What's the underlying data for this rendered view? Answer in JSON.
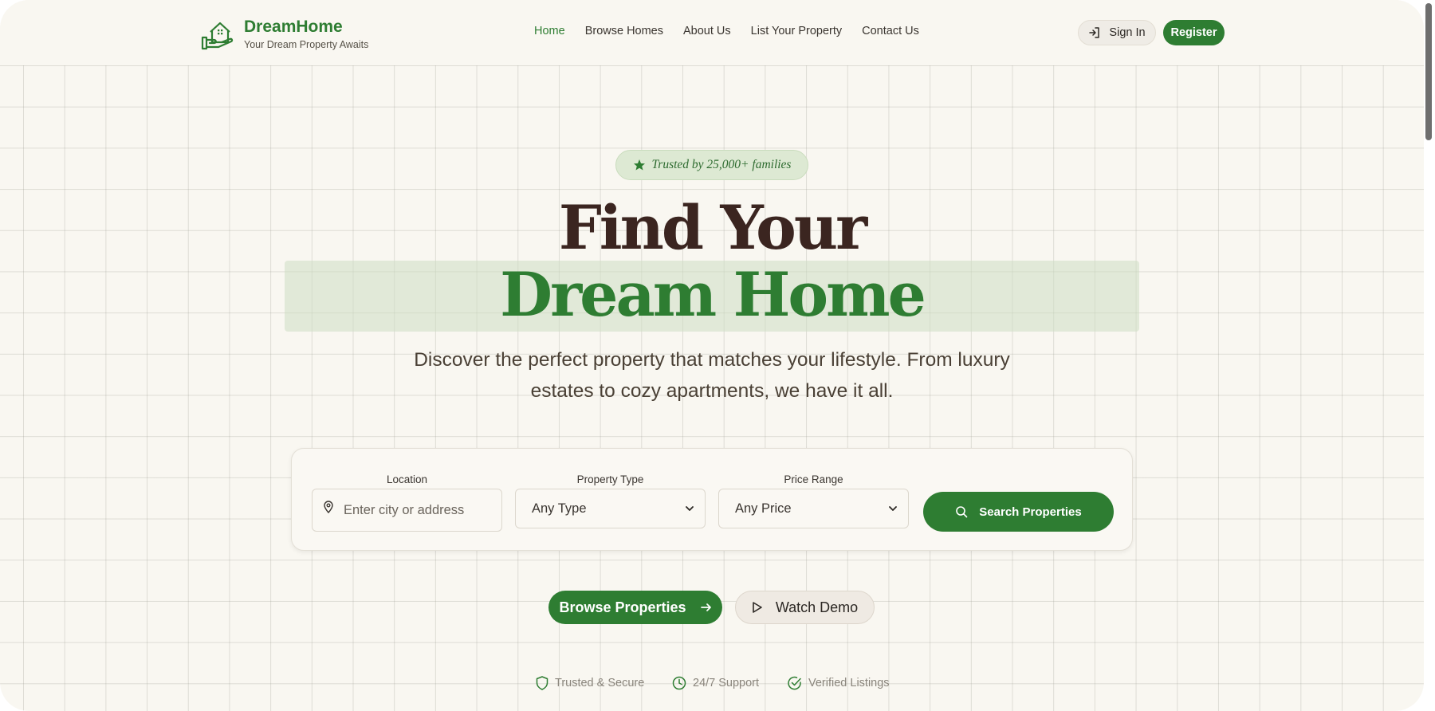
{
  "brand": {
    "name": "DreamHome",
    "tagline": "Your Dream Property Awaits",
    "icon": "house-hand-icon"
  },
  "nav": {
    "items": [
      {
        "label": "Home",
        "active": true
      },
      {
        "label": "Browse Homes",
        "active": false
      },
      {
        "label": "About Us",
        "active": false
      },
      {
        "label": "List Your Property",
        "active": false
      },
      {
        "label": "Contact Us",
        "active": false
      }
    ]
  },
  "auth": {
    "sign_in_label": "Sign In",
    "register_label": "Register"
  },
  "hero": {
    "badge_text": "Trusted by 25,000+ families",
    "title_line1": "Find Your",
    "title_line2": "Dream Home",
    "subtitle": "Discover the perfect property that matches your lifestyle. From luxury estates to cozy apartments, we have it all."
  },
  "search": {
    "location_label": "Location",
    "location_placeholder": "Enter city or address",
    "type_label": "Property Type",
    "type_value": "Any Type",
    "price_label": "Price Range",
    "price_value": "Any Price",
    "button_label": "Search Properties"
  },
  "cta": {
    "browse_label": "Browse Properties",
    "demo_label": "Watch Demo"
  },
  "trust_items": [
    {
      "label": "Trusted & Secure",
      "icon": "shield-icon"
    },
    {
      "label": "24/7 Support",
      "icon": "clock-icon"
    },
    {
      "label": "Verified Listings",
      "icon": "check-circle-icon"
    }
  ],
  "colors": {
    "primary": "#2e7d32",
    "heading_dark": "#3b2520",
    "background": "#f9f7f1"
  }
}
